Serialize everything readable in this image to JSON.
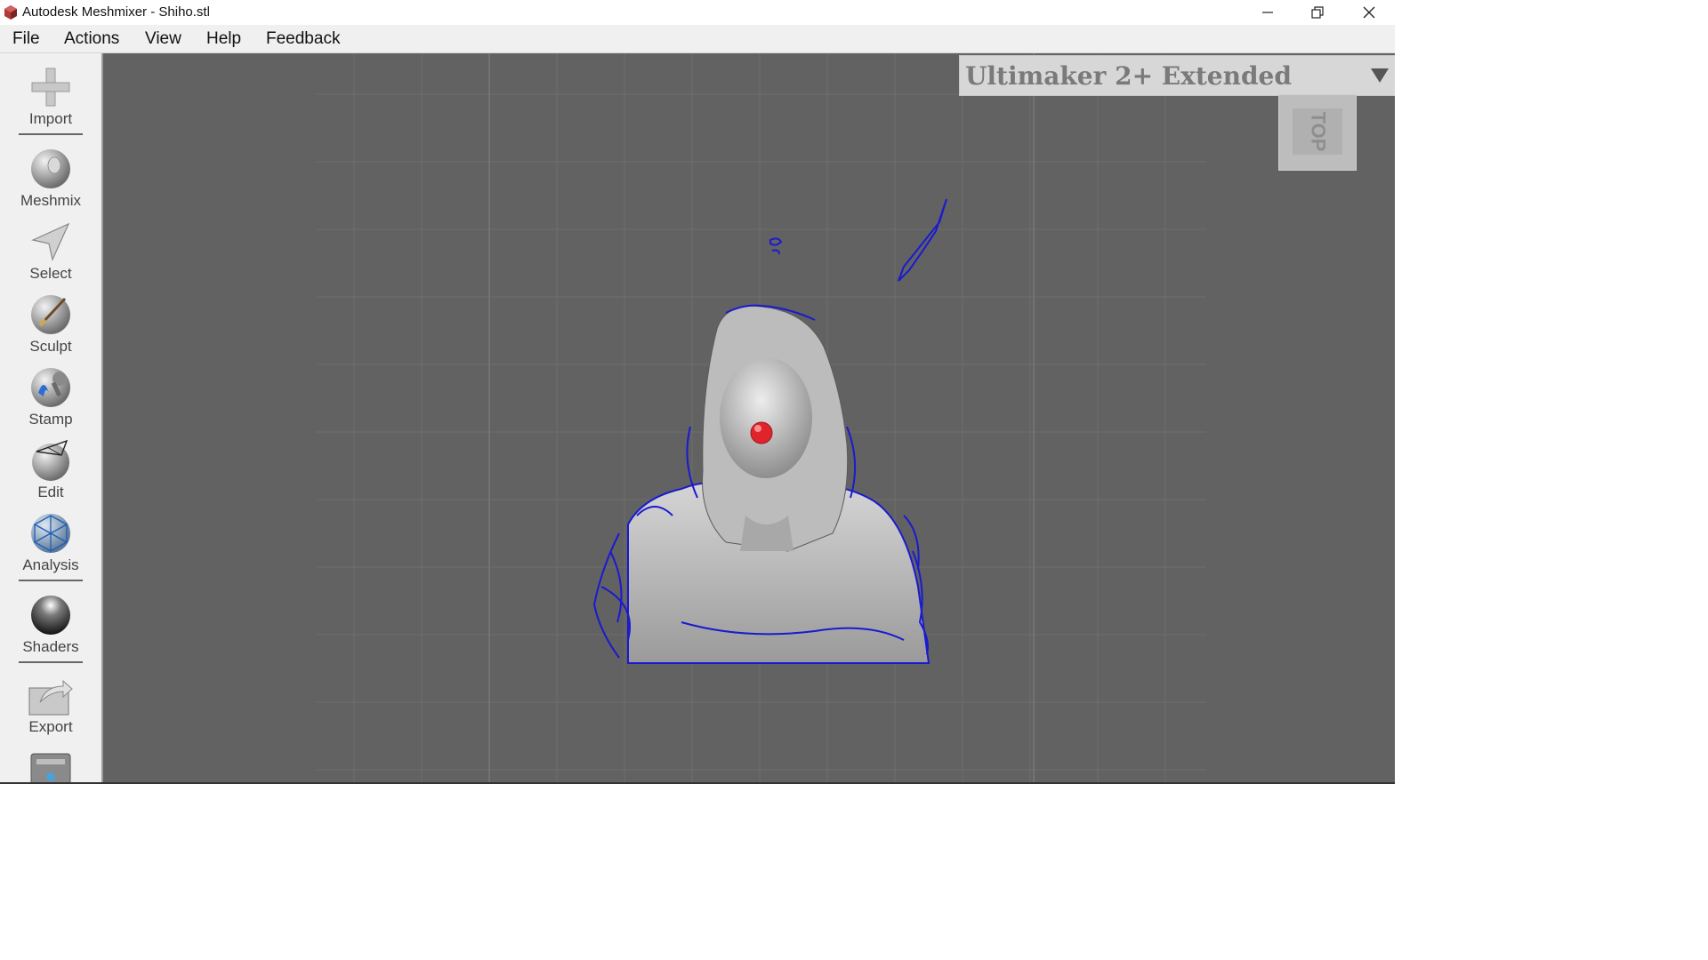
{
  "window": {
    "title": "Autodesk Meshmixer - Shiho.stl",
    "controls": [
      "minimize-icon",
      "restore-icon",
      "close-icon"
    ]
  },
  "menu": {
    "file": "File",
    "actions": "Actions",
    "view": "View",
    "help": "Help",
    "feedback": "Feedback"
  },
  "toolbar": {
    "import": "Import",
    "meshmix": "Meshmix",
    "select": "Select",
    "sculpt": "Sculpt",
    "stamp": "Stamp",
    "edit": "Edit",
    "analysis": "Analysis",
    "shaders": "Shaders",
    "export": "Export"
  },
  "viewport": {
    "printer": "Ultimaker 2+ Extended",
    "viewcube_label": "TOP",
    "background_color": "#626262",
    "mesh_boundary_color": "#1a1ad0",
    "brush_marker_color": "#e0242c"
  }
}
